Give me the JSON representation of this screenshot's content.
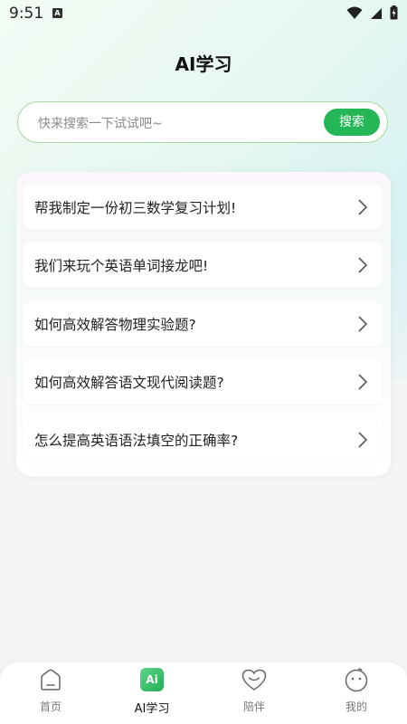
{
  "status_bar": {
    "time": "9:51",
    "notification_letter": "A"
  },
  "header": {
    "title": "AI学习"
  },
  "search": {
    "placeholder": "快来搜索一下试试吧~",
    "button_label": "搜索"
  },
  "questions": [
    {
      "text": "帮我制定一份初三数学复习计划!"
    },
    {
      "text": "我们来玩个英语单词接龙吧!"
    },
    {
      "text": "如何高效解答物理实验题?"
    },
    {
      "text": "如何高效解答语文现代阅读题?"
    },
    {
      "text": "怎么提高英语语法填空的正确率?"
    }
  ],
  "tabbar": {
    "tabs": [
      {
        "label": "首页",
        "icon": "home-icon",
        "active": false
      },
      {
        "label": "AI学习",
        "icon": "ai-icon",
        "icon_text": "Ai",
        "active": true
      },
      {
        "label": "陪伴",
        "icon": "heart-smile-icon",
        "active": false
      },
      {
        "label": "我的",
        "icon": "face-icon",
        "active": false
      }
    ]
  },
  "colors": {
    "accent": "#24b657",
    "search_border": "#a8d99e",
    "text": "#222222"
  }
}
